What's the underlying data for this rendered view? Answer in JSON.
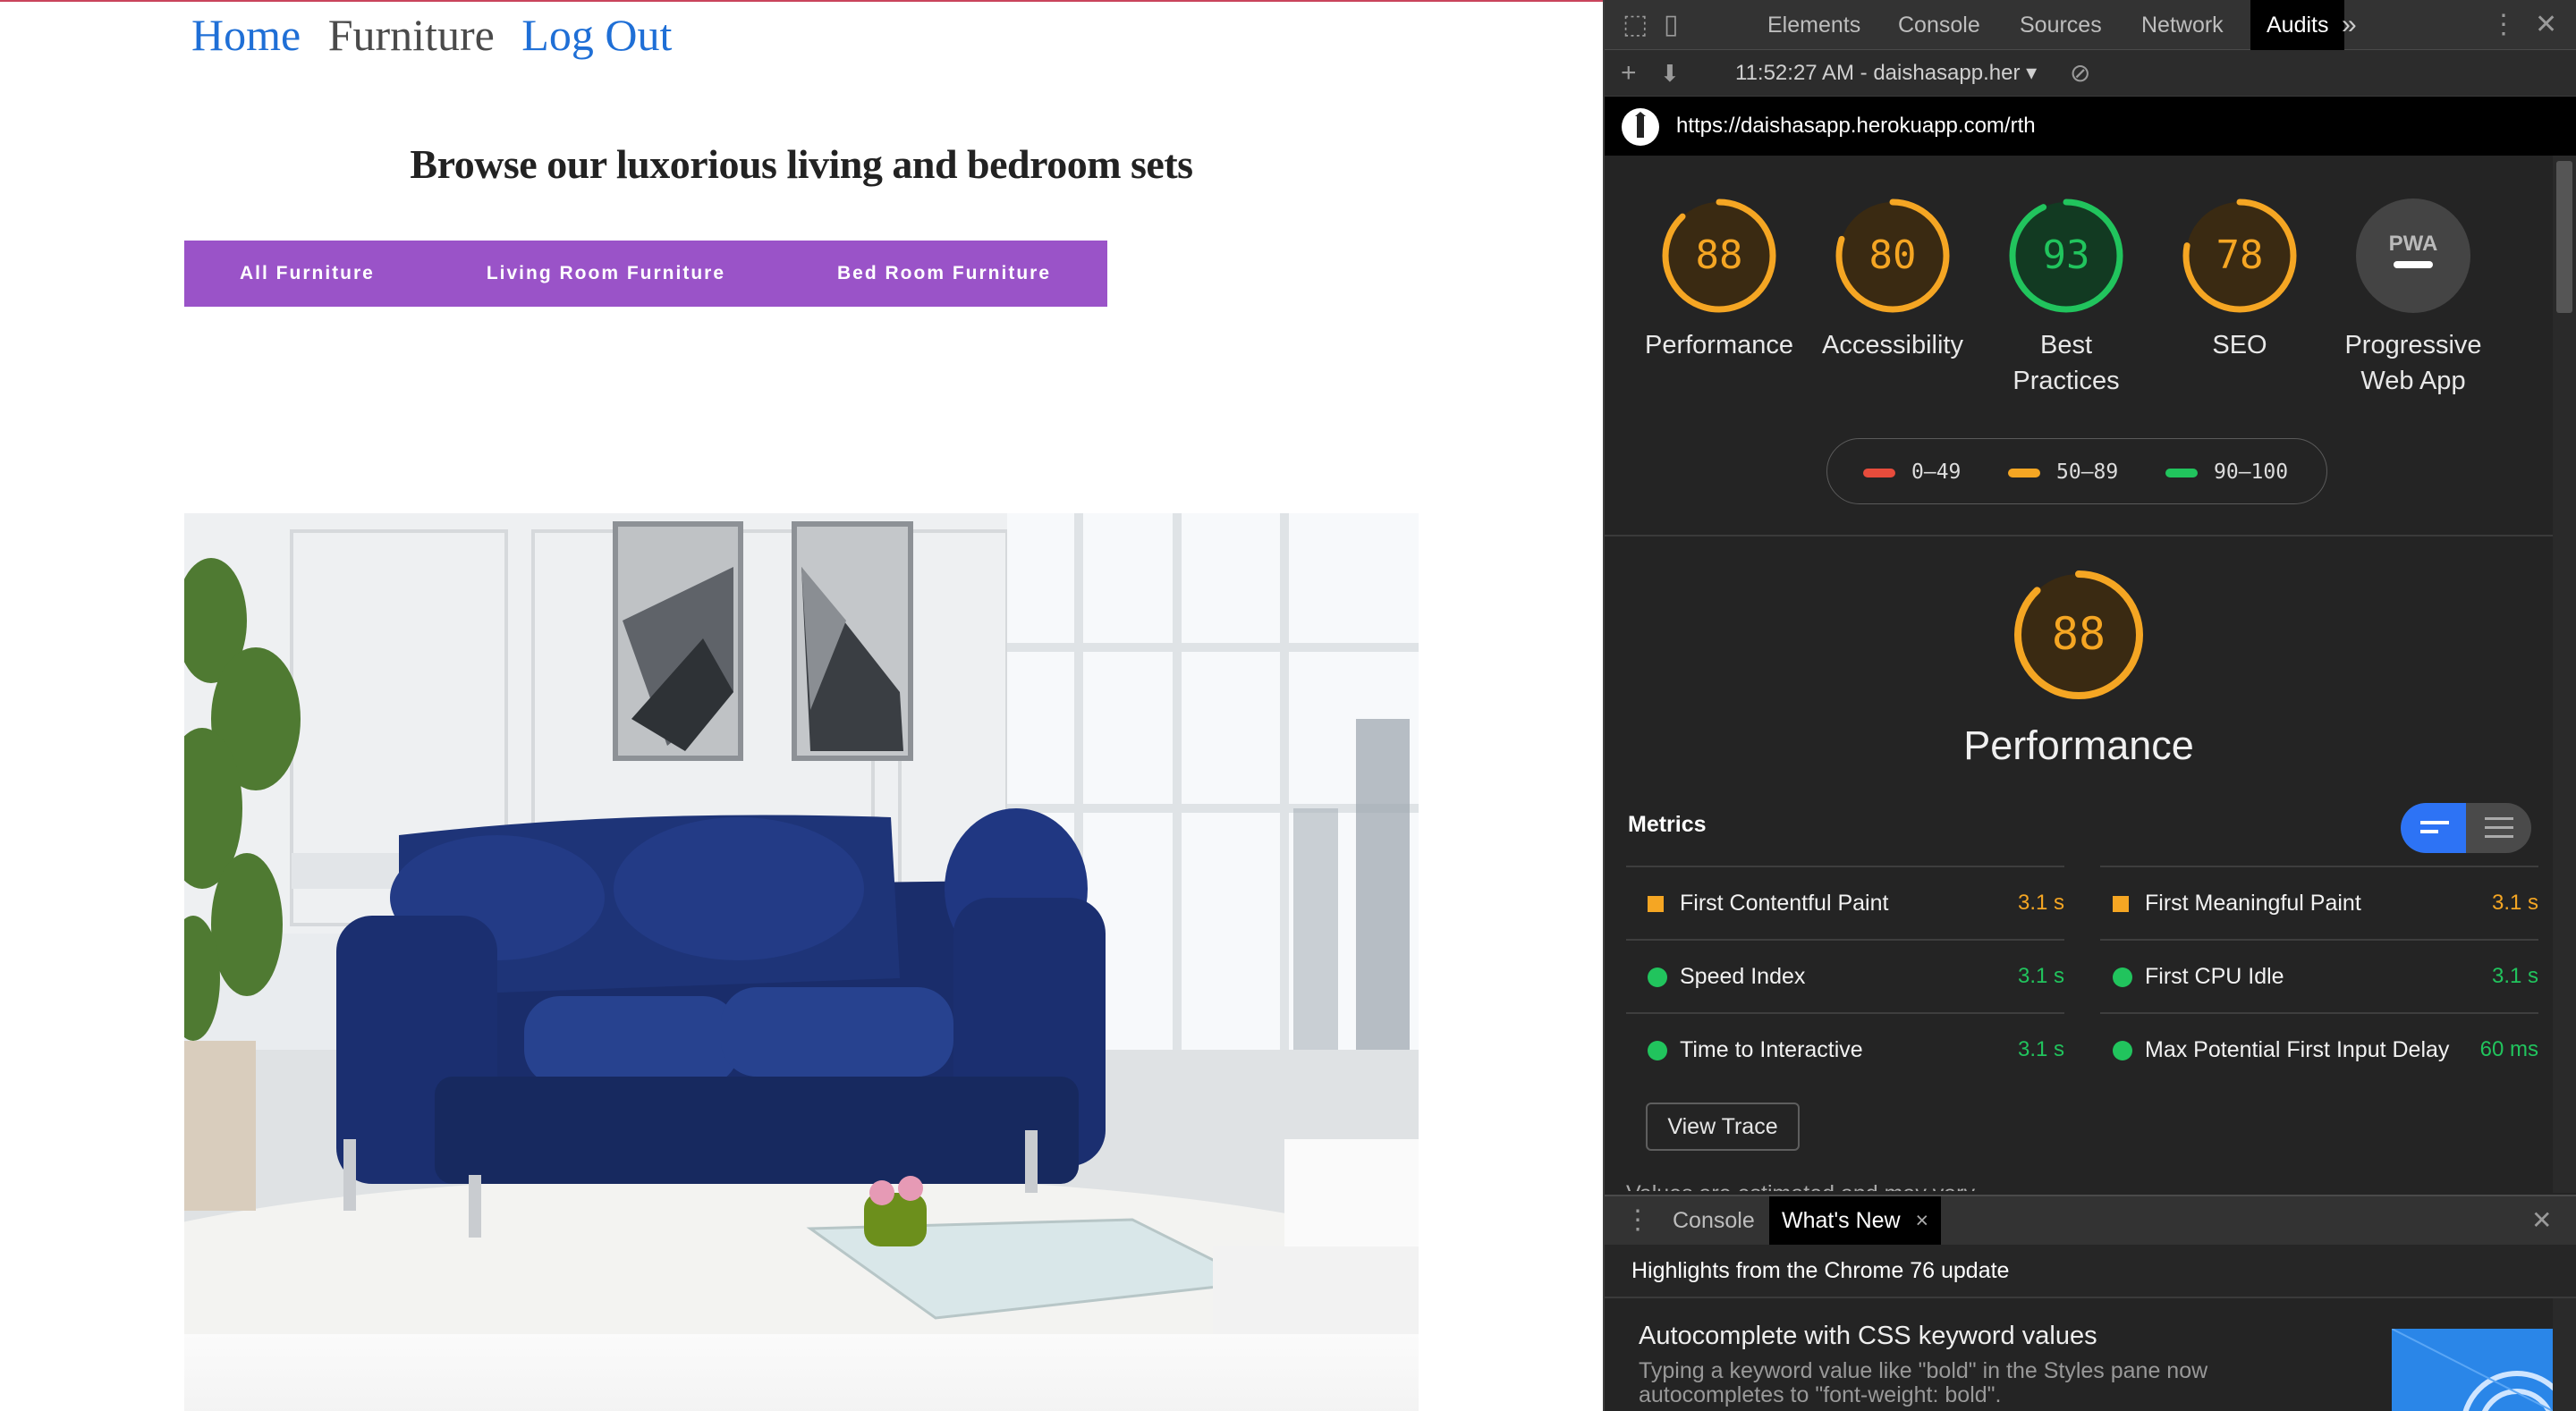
{
  "site": {
    "nav": {
      "home": "Home",
      "furniture": "Furniture",
      "logout": "Log Out"
    },
    "heading": "Browse our luxorious living and bedroom sets",
    "categories": [
      "All Furniture",
      "Living Room Furniture",
      "Bed Room Furniture"
    ],
    "category_bar_color": "#9a53c8",
    "photo_alt": "navy-velvet-sofa-living-room-photo"
  },
  "devtools": {
    "tabs": [
      "Elements",
      "Console",
      "Sources",
      "Network",
      "Audits"
    ],
    "active_tab": "Audits",
    "more_tabs": "»",
    "report_label": "11:52:27 AM - daishasapp.her",
    "url": "https://daishasapp.herokuapp.com/rth",
    "scores": [
      {
        "label": "Performance",
        "value": "88",
        "level": 0.88,
        "color": "#f5a623"
      },
      {
        "label": "Accessibility",
        "value": "80",
        "level": 0.8,
        "color": "#f5a623"
      },
      {
        "label": "Best Practices",
        "value": "93",
        "level": 0.93,
        "color": "#21c45d"
      },
      {
        "label": "SEO",
        "value": "78",
        "level": 0.78,
        "color": "#f5a623"
      },
      {
        "label": "Progressive Web App",
        "value": "PWA",
        "color": "#9e9e9e"
      }
    ],
    "legend": [
      {
        "range": "0–49",
        "color": "#e74c3c"
      },
      {
        "range": "50–89",
        "color": "#f5a623"
      },
      {
        "range": "90–100",
        "color": "#21c45d"
      }
    ],
    "performance": {
      "score": "88",
      "level": 0.88,
      "title": "Performance"
    },
    "metrics_title": "Metrics",
    "metrics_left": [
      {
        "name": "First Contentful Paint",
        "value": "3.1 s",
        "status": "average"
      },
      {
        "name": "Speed Index",
        "value": "3.1 s",
        "status": "pass"
      },
      {
        "name": "Time to Interactive",
        "value": "3.1 s",
        "status": "pass"
      }
    ],
    "metrics_right": [
      {
        "name": "First Meaningful Paint",
        "value": "3.1 s",
        "status": "average"
      },
      {
        "name": "First CPU Idle",
        "value": "3.1 s",
        "status": "pass"
      },
      {
        "name": "Max Potential First Input Delay",
        "value": "60 ms",
        "status": "pass"
      }
    ],
    "view_trace": "View Trace",
    "cut_text": "Values are estimated and may vary.",
    "drawer": {
      "tabs": [
        "Console",
        "What's New"
      ],
      "active_tab": "What's New",
      "close": "×",
      "highlights": "Highlights from the Chrome 76 update",
      "item_title": "Autocomplete with CSS keyword values",
      "item_desc": "Typing a keyword value like \"bold\" in the Styles pane now autocompletes to \"font-weight: bold\"."
    },
    "colors": {
      "average": "#f5a623",
      "pass": "#21c45d",
      "fail": "#e74c3c"
    }
  }
}
